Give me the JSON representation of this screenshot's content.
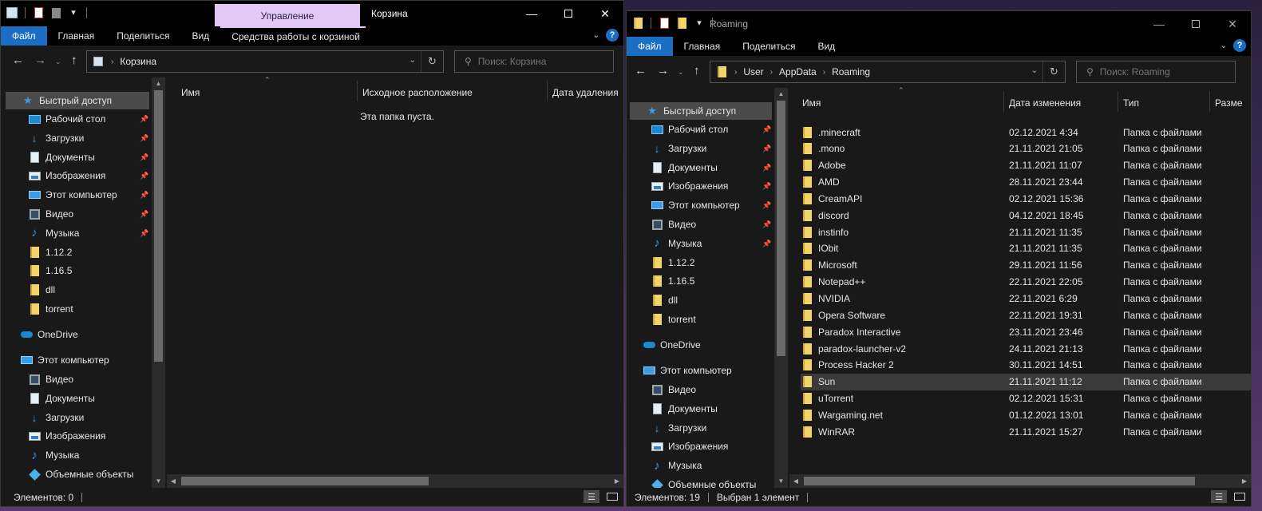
{
  "left_window": {
    "title": "Корзина",
    "manage_tab": "Управление",
    "ribbon_tabs": [
      "Файл",
      "Главная",
      "Поделиться",
      "Вид",
      "Средства работы с корзиной"
    ],
    "address": [
      "Корзина"
    ],
    "search_placeholder": "Поиск: Корзина",
    "nav": {
      "quick_access": "Быстрый доступ",
      "items": [
        {
          "label": "Рабочий стол",
          "icon": "desktop-icon",
          "pinned": true
        },
        {
          "label": "Загрузки",
          "icon": "downloads-icon",
          "pinned": true
        },
        {
          "label": "Документы",
          "icon": "documents-icon",
          "pinned": true
        },
        {
          "label": "Изображения",
          "icon": "pictures-icon",
          "pinned": true
        },
        {
          "label": "Этот компьютер",
          "icon": "computer-icon",
          "pinned": true
        },
        {
          "label": "Видео",
          "icon": "video-icon",
          "pinned": true
        },
        {
          "label": "Музыка",
          "icon": "music-icon",
          "pinned": true
        },
        {
          "label": "1.12.2",
          "icon": "folder-icon",
          "pinned": false
        },
        {
          "label": "1.16.5",
          "icon": "folder-icon",
          "pinned": false
        },
        {
          "label": "dll",
          "icon": "folder-icon",
          "pinned": false
        },
        {
          "label": "torrent",
          "icon": "folder-icon",
          "pinned": false
        }
      ],
      "onedrive": "OneDrive",
      "this_pc": "Этот компьютер",
      "pc_items": [
        {
          "label": "Видео",
          "icon": "video-icon"
        },
        {
          "label": "Документы",
          "icon": "documents-icon"
        },
        {
          "label": "Загрузки",
          "icon": "downloads-icon"
        },
        {
          "label": "Изображения",
          "icon": "pictures-icon"
        },
        {
          "label": "Музыка",
          "icon": "music-icon"
        },
        {
          "label": "Объемные объекты",
          "icon": "3d-objects-icon"
        }
      ]
    },
    "columns": [
      "Имя",
      "Исходное расположение",
      "Дата удаления"
    ],
    "empty_message": "Эта папка пуста.",
    "status": "Элементов: 0"
  },
  "right_window": {
    "title": "Roaming",
    "ribbon_tabs": [
      "Файл",
      "Главная",
      "Поделиться",
      "Вид"
    ],
    "address": [
      "User",
      "AppData",
      "Roaming"
    ],
    "search_placeholder": "Поиск: Roaming",
    "nav": {
      "quick_access": "Быстрый доступ",
      "items": [
        {
          "label": "Рабочий стол",
          "icon": "desktop-icon",
          "pinned": true
        },
        {
          "label": "Загрузки",
          "icon": "downloads-icon",
          "pinned": true
        },
        {
          "label": "Документы",
          "icon": "documents-icon",
          "pinned": true
        },
        {
          "label": "Изображения",
          "icon": "pictures-icon",
          "pinned": true
        },
        {
          "label": "Этот компьютер",
          "icon": "computer-icon",
          "pinned": true
        },
        {
          "label": "Видео",
          "icon": "video-icon",
          "pinned": true
        },
        {
          "label": "Музыка",
          "icon": "music-icon",
          "pinned": true
        },
        {
          "label": "1.12.2",
          "icon": "folder-icon",
          "pinned": false
        },
        {
          "label": "1.16.5",
          "icon": "folder-icon",
          "pinned": false
        },
        {
          "label": "dll",
          "icon": "folder-icon",
          "pinned": false
        },
        {
          "label": "torrent",
          "icon": "folder-icon",
          "pinned": false
        }
      ],
      "onedrive": "OneDrive",
      "this_pc": "Этот компьютер",
      "pc_items": [
        {
          "label": "Видео",
          "icon": "video-icon"
        },
        {
          "label": "Документы",
          "icon": "documents-icon"
        },
        {
          "label": "Загрузки",
          "icon": "downloads-icon"
        },
        {
          "label": "Изображения",
          "icon": "pictures-icon"
        },
        {
          "label": "Музыка",
          "icon": "music-icon"
        },
        {
          "label": "Объемные объекты",
          "icon": "3d-objects-icon"
        }
      ]
    },
    "columns": [
      "Имя",
      "Дата изменения",
      "Тип",
      "Разме"
    ],
    "files": [
      {
        "name": ".minecraft",
        "date": "02.12.2021 4:34",
        "type": "Папка с файлами"
      },
      {
        "name": ".mono",
        "date": "21.11.2021 21:05",
        "type": "Папка с файлами"
      },
      {
        "name": "Adobe",
        "date": "21.11.2021 11:07",
        "type": "Папка с файлами"
      },
      {
        "name": "AMD",
        "date": "28.11.2021 23:44",
        "type": "Папка с файлами"
      },
      {
        "name": "CreamAPI",
        "date": "02.12.2021 15:36",
        "type": "Папка с файлами"
      },
      {
        "name": "discord",
        "date": "04.12.2021 18:45",
        "type": "Папка с файлами"
      },
      {
        "name": "instinfo",
        "date": "21.11.2021 11:35",
        "type": "Папка с файлами"
      },
      {
        "name": "IObit",
        "date": "21.11.2021 11:35",
        "type": "Папка с файлами"
      },
      {
        "name": "Microsoft",
        "date": "29.11.2021 11:56",
        "type": "Папка с файлами"
      },
      {
        "name": "Notepad++",
        "date": "22.11.2021 22:05",
        "type": "Папка с файлами"
      },
      {
        "name": "NVIDIA",
        "date": "22.11.2021 6:29",
        "type": "Папка с файлами"
      },
      {
        "name": "Opera Software",
        "date": "22.11.2021 19:31",
        "type": "Папка с файлами"
      },
      {
        "name": "Paradox Interactive",
        "date": "23.11.2021 23:46",
        "type": "Папка с файлами"
      },
      {
        "name": "paradox-launcher-v2",
        "date": "24.11.2021 21:13",
        "type": "Папка с файлами"
      },
      {
        "name": "Process Hacker 2",
        "date": "30.11.2021 14:51",
        "type": "Папка с файлами"
      },
      {
        "name": "Sun",
        "date": "21.11.2021 11:12",
        "type": "Папка с файлами",
        "selected": true
      },
      {
        "name": "uTorrent",
        "date": "02.12.2021 15:31",
        "type": "Папка с файлами"
      },
      {
        "name": "Wargaming.net",
        "date": "01.12.2021 13:01",
        "type": "Папка с файлами"
      },
      {
        "name": "WinRAR",
        "date": "21.11.2021 15:27",
        "type": "Папка с файлами"
      }
    ],
    "status": "Элементов: 19",
    "status_selected": "Выбран 1 элемент"
  },
  "colors": {
    "accent": "#1a6fc4",
    "manage_tab": "#e3c8f5",
    "folder": "#f2d46a",
    "background": "#191919"
  }
}
